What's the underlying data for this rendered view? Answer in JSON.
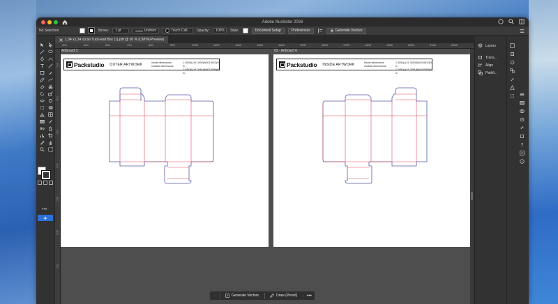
{
  "app": {
    "title": "Adobe Illustrator 2026"
  },
  "control_bar": {
    "selection": "No Selection",
    "stroke_label": "Stroke:",
    "stroke_weight": "1 pt",
    "profile": "Uniform",
    "brush": "Touch Call...",
    "opacity_label": "Opacity:",
    "opacity_value": "100%",
    "style_label": "Style:",
    "document_setup": "Document Setup",
    "preferences": "Preferences",
    "generate_vectors": "Generate Vectors"
  },
  "document_tab": {
    "name": "1.34 x1.34 x3.66 Tuck-end Box (1).pdf @ 50 % (CMYK/Preview)"
  },
  "ruler": {
    "marks": [
      "400",
      "500",
      "600",
      "700",
      "800",
      "900",
      "1000",
      "1100",
      "1200",
      "1300",
      "1400",
      "1500",
      "1600",
      "1700",
      "1800",
      "1900",
      "2000",
      "2100",
      "2200"
    ],
    "left_marks": [
      "100",
      "200",
      "300",
      "400",
      "500",
      "600",
      "700"
    ]
  },
  "artboards": [
    {
      "label": "Artboard 3",
      "logo": "Packstudio",
      "artwork_label": "OUTER ARTWORK",
      "dim1_label": "Inside dimensions",
      "dim1_value": "1.3000(L)X1.3000(W)X3.5812(H) in",
      "dim2_label": "Outside dimensions",
      "dim2_value": "1.3461(L)X1.3461(W)X3.6595(H) in"
    },
    {
      "label": "03 - Artboard 6",
      "logo": "Packstudio",
      "artwork_label": "INSIDE ARTWORK",
      "dim1_label": "Inside dimensions",
      "dim1_value": "1.3000(L)X1.3000(W)X3.6812(H) in",
      "dim2_label": "Outside dimensions",
      "dim2_value": "1.3461(L)X1.3461(W)X3.6595(H) in"
    }
  ],
  "panels": {
    "layers": "Layers",
    "transform": "Trans...",
    "align": "Align",
    "pathfinder": "Pathfi..."
  },
  "taskbar": {
    "generate_vectors": "Generate Vectors",
    "draw": "Draw (Pencil)"
  },
  "colors": {
    "close": "#ff5f57",
    "minimize": "#febc2e",
    "zoom": "#28c840",
    "cut_line": "#e24b5a",
    "fold_line": "#5a5aa8",
    "accent": "#2e6fd8"
  },
  "icons": [
    "home-icon",
    "search-icon",
    "share-icon",
    "gear-icon",
    "close-icon",
    "layers-icon",
    "transform-icon",
    "align-icon",
    "pathfinder-icon",
    "pencil-icon",
    "sparkle-icon"
  ]
}
